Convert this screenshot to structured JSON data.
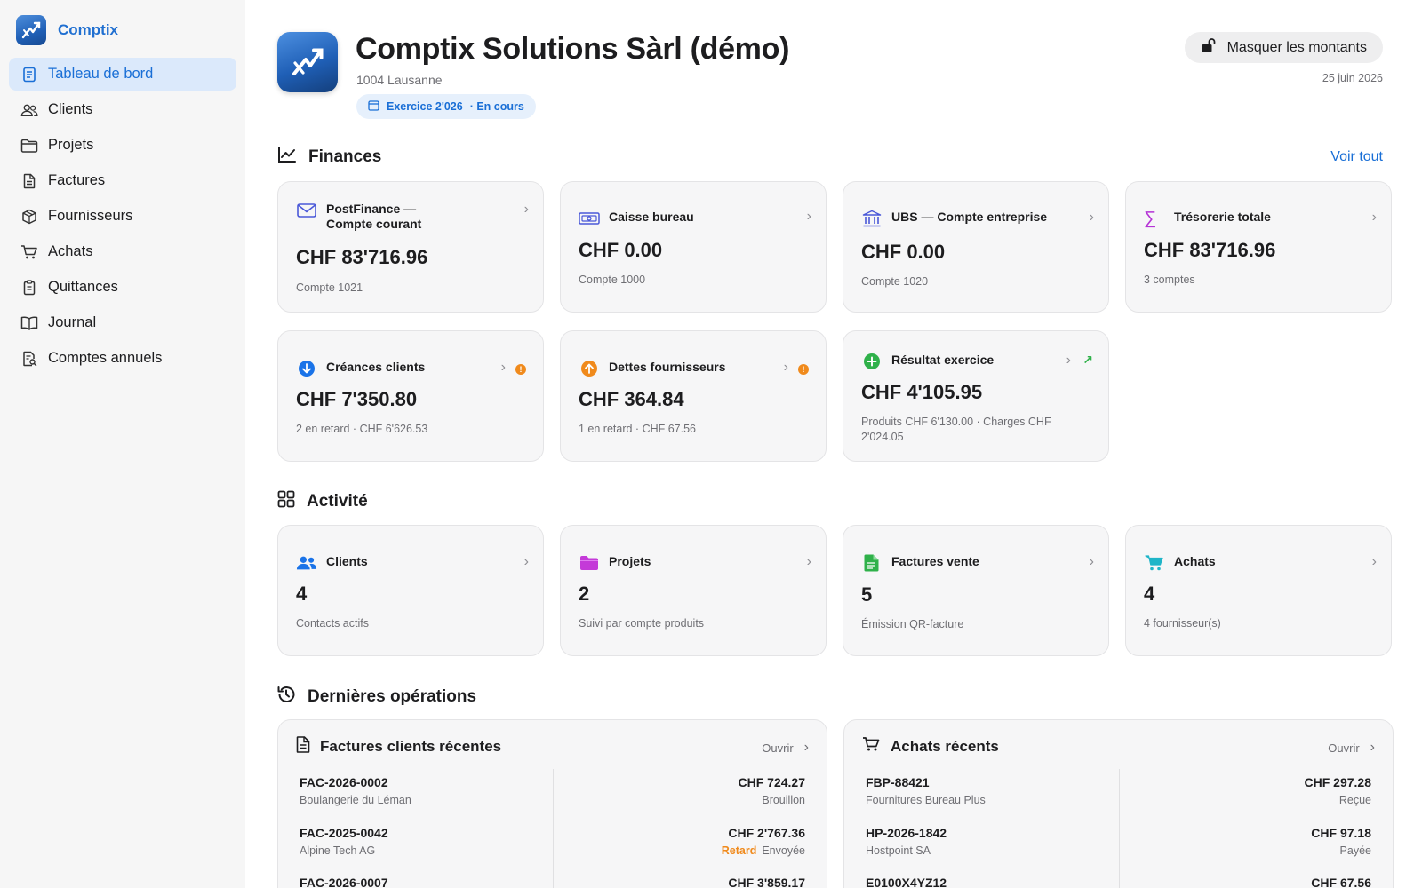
{
  "app": {
    "name": "Comptix",
    "colors": {
      "accent": "#1a6fd6",
      "activeBg": "#dbe9fb",
      "warning": "#f08a1c"
    }
  },
  "sidebar": {
    "items": [
      {
        "label": "Tableau de bord",
        "icon": "dashboard-icon",
        "active": true
      },
      {
        "label": "Clients",
        "icon": "users-icon"
      },
      {
        "label": "Projets",
        "icon": "folder-icon"
      },
      {
        "label": "Factures",
        "icon": "document-icon"
      },
      {
        "label": "Fournisseurs",
        "icon": "box-icon"
      },
      {
        "label": "Achats",
        "icon": "cart-icon"
      },
      {
        "label": "Quittances",
        "icon": "receipt-icon"
      },
      {
        "label": "Journal",
        "icon": "book-icon"
      },
      {
        "label": "Comptes annuels",
        "icon": "report-search-icon"
      }
    ]
  },
  "header": {
    "title": "Comptix Solutions Sàrl (démo)",
    "city": "1004 Lausanne",
    "exercise": "Exercice 2'026",
    "exercise_status": "· En cours",
    "mask_button": "Masquer les montants",
    "date": "25 juin 2026"
  },
  "finances": {
    "title": "Finances",
    "see_all": "Voir tout",
    "cards": [
      {
        "title": "PostFinance — Compte courant",
        "value": "CHF 83'716.96",
        "sub": "Compte 1021",
        "icon": "envelope-icon"
      },
      {
        "title": "Caisse bureau",
        "value": "CHF 0.00",
        "sub": "Compte 1000",
        "icon": "banknote-icon"
      },
      {
        "title": "UBS — Compte entreprise",
        "value": "CHF 0.00",
        "sub": "Compte 1020",
        "icon": "bank-icon"
      },
      {
        "title": "Trésorerie totale",
        "value": "CHF 83'716.96",
        "sub": "3 comptes",
        "icon": "sigma-icon"
      },
      {
        "title": "Créances clients",
        "value": "CHF 7'350.80",
        "sub": "2 en retard · CHF 6'626.53",
        "icon": "arrow-down-circle-icon",
        "alert": "!"
      },
      {
        "title": "Dettes fournisseurs",
        "value": "CHF 364.84",
        "sub": "1 en retard · CHF 67.56",
        "icon": "arrow-up-circle-icon",
        "alert": "!"
      },
      {
        "title": "Résultat exercice",
        "value": "CHF 4'105.95",
        "sub": "Produits CHF 6'130.00 · Charges CHF 2'024.05",
        "icon": "plus-circle-icon",
        "trend": "↗"
      }
    ]
  },
  "activity": {
    "title": "Activité",
    "cards": [
      {
        "title": "Clients",
        "value": "4",
        "sub": "Contacts actifs",
        "icon": "people-icon"
      },
      {
        "title": "Projets",
        "value": "2",
        "sub": "Suivi par compte produits",
        "icon": "folder-fill-icon"
      },
      {
        "title": "Factures vente",
        "value": "5",
        "sub": "Émission QR-facture",
        "icon": "document-fill-icon"
      },
      {
        "title": "Achats",
        "value": "4",
        "sub": "4 fournisseur(s)",
        "icon": "cart-fill-icon"
      }
    ]
  },
  "recent": {
    "title": "Dernières opérations",
    "invoices": {
      "title": "Factures clients récentes",
      "open": "Ouvrir",
      "rows": [
        {
          "ref": "FAC-2026-0002",
          "name": "Boulangerie du Léman",
          "amount": "CHF 724.27",
          "late": "",
          "status": "Brouillon"
        },
        {
          "ref": "FAC-2025-0042",
          "name": "Alpine Tech AG",
          "amount": "CHF 2'767.36",
          "late": "Retard",
          "status": "Envoyée"
        },
        {
          "ref": "FAC-2026-0007",
          "name": "",
          "amount": "CHF 3'859.17",
          "late": "",
          "status": ""
        }
      ]
    },
    "purchases": {
      "title": "Achats récents",
      "open": "Ouvrir",
      "rows": [
        {
          "ref": "FBP-88421",
          "name": "Fournitures Bureau Plus",
          "amount": "CHF 297.28",
          "late": "",
          "status": "Reçue"
        },
        {
          "ref": "HP-2026-1842",
          "name": "Hostpoint SA",
          "amount": "CHF 97.18",
          "late": "",
          "status": "Payée"
        },
        {
          "ref": "E0100X4YZ12",
          "name": "",
          "amount": "CHF 67.56",
          "late": "",
          "status": ""
        }
      ]
    }
  }
}
